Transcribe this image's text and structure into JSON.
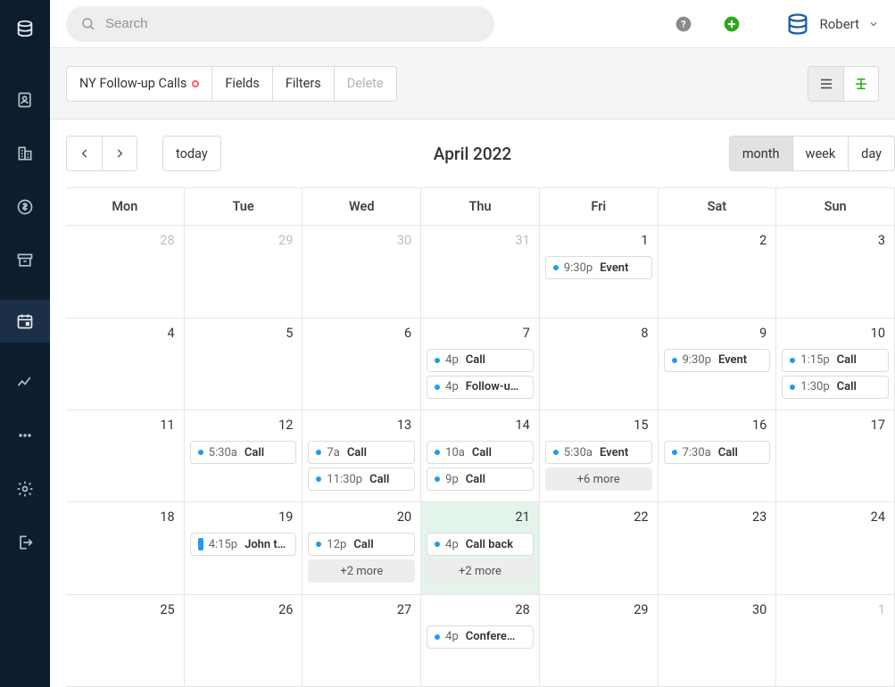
{
  "sidebar": {
    "items": [
      {
        "name": "contacts-icon"
      },
      {
        "name": "companies-icon"
      },
      {
        "name": "deals-icon"
      },
      {
        "name": "archive-icon"
      },
      {
        "name": "calendar-icon",
        "active": true
      },
      {
        "name": "reports-icon"
      },
      {
        "name": "more-icon"
      },
      {
        "name": "settings-icon"
      },
      {
        "name": "logout-icon"
      }
    ]
  },
  "topbar": {
    "search_placeholder": "Search",
    "user_name": "Robert"
  },
  "toolbar": {
    "view_name": "NY Follow-up Calls",
    "fields": "Fields",
    "filters": "Filters",
    "delete": "Delete"
  },
  "calendar": {
    "title": "April 2022",
    "today_label": "today",
    "ranges": {
      "month": "month",
      "week": "week",
      "day": "day",
      "active": "month"
    },
    "dow": [
      "Mon",
      "Tue",
      "Wed",
      "Thu",
      "Fri",
      "Sat",
      "Sun"
    ],
    "weeks": [
      [
        {
          "num": "28",
          "other": true,
          "events": []
        },
        {
          "num": "29",
          "other": true,
          "events": []
        },
        {
          "num": "30",
          "other": true,
          "events": []
        },
        {
          "num": "31",
          "other": true,
          "events": []
        },
        {
          "num": "1",
          "events": [
            {
              "time": "9:30p",
              "title": "Event"
            }
          ]
        },
        {
          "num": "2",
          "events": []
        },
        {
          "num": "3",
          "events": []
        }
      ],
      [
        {
          "num": "4",
          "events": []
        },
        {
          "num": "5",
          "events": []
        },
        {
          "num": "6",
          "events": []
        },
        {
          "num": "7",
          "events": [
            {
              "time": "4p",
              "title": "Call"
            },
            {
              "time": "4p",
              "title": "Follow-u…"
            }
          ]
        },
        {
          "num": "8",
          "events": []
        },
        {
          "num": "9",
          "events": [
            {
              "time": "9:30p",
              "title": "Event"
            }
          ]
        },
        {
          "num": "10",
          "events": [
            {
              "time": "1:15p",
              "title": "Call"
            },
            {
              "time": "1:30p",
              "title": "Call"
            }
          ]
        }
      ],
      [
        {
          "num": "11",
          "events": []
        },
        {
          "num": "12",
          "events": [
            {
              "time": "5:30a",
              "title": "Call"
            }
          ]
        },
        {
          "num": "13",
          "events": [
            {
              "time": "7a",
              "title": "Call"
            },
            {
              "time": "11:30p",
              "title": "Call"
            }
          ]
        },
        {
          "num": "14",
          "events": [
            {
              "time": "10a",
              "title": "Call"
            },
            {
              "time": "9p",
              "title": "Call"
            }
          ]
        },
        {
          "num": "15",
          "events": [
            {
              "time": "5:30a",
              "title": "Event"
            }
          ],
          "more": "+6 more"
        },
        {
          "num": "16",
          "events": [
            {
              "time": "7:30a",
              "title": "Call"
            }
          ]
        },
        {
          "num": "17",
          "events": []
        }
      ],
      [
        {
          "num": "18",
          "events": []
        },
        {
          "num": "19",
          "events": [
            {
              "time": "4:15p",
              "title": "John t…",
              "bar": true
            }
          ]
        },
        {
          "num": "20",
          "events": [
            {
              "time": "12p",
              "title": "Call"
            }
          ],
          "more": "+2 more"
        },
        {
          "num": "21",
          "today": true,
          "events": [
            {
              "time": "4p",
              "title": "Call back"
            }
          ],
          "more": "+2 more"
        },
        {
          "num": "22",
          "events": []
        },
        {
          "num": "23",
          "events": []
        },
        {
          "num": "24",
          "events": []
        }
      ],
      [
        {
          "num": "25",
          "events": []
        },
        {
          "num": "26",
          "events": []
        },
        {
          "num": "27",
          "events": []
        },
        {
          "num": "28",
          "events": [
            {
              "time": "4p",
              "title": "Confere…"
            }
          ]
        },
        {
          "num": "29",
          "events": []
        },
        {
          "num": "30",
          "events": []
        },
        {
          "num": "1",
          "other": true,
          "events": []
        }
      ]
    ]
  }
}
